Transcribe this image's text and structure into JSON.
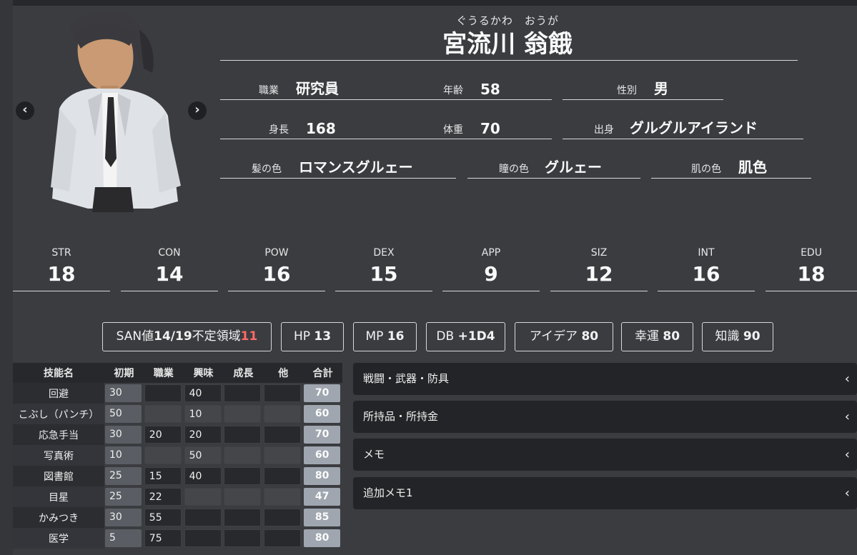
{
  "character": {
    "ruby": "ぐうるかわ　おうが",
    "name": "宮流川 翁餓"
  },
  "profile": {
    "occupation": {
      "label": "職業",
      "value": "研究員"
    },
    "age": {
      "label": "年齢",
      "value": "58"
    },
    "sex": {
      "label": "性別",
      "value": "男"
    },
    "height": {
      "label": "身長",
      "value": "168"
    },
    "weight": {
      "label": "体重",
      "value": "70"
    },
    "origin": {
      "label": "出身",
      "value": "グルグルアイランド"
    },
    "hair": {
      "label": "髪の色",
      "value": "ロマンスグルェー"
    },
    "eyes": {
      "label": "瞳の色",
      "value": "グルェー"
    },
    "skin": {
      "label": "肌の色",
      "value": "肌色"
    }
  },
  "stats": [
    {
      "label": "STR",
      "value": "18"
    },
    {
      "label": "CON",
      "value": "14"
    },
    {
      "label": "POW",
      "value": "16"
    },
    {
      "label": "DEX",
      "value": "15"
    },
    {
      "label": "APP",
      "value": "9"
    },
    {
      "label": "SIZ",
      "value": "12"
    },
    {
      "label": "INT",
      "value": "16"
    },
    {
      "label": "EDU",
      "value": "18"
    }
  ],
  "derived": {
    "san": {
      "prefix": "SAN値",
      "value": "14/19",
      "middle": "不定領域",
      "indefinite": "11"
    },
    "hp": {
      "label": "HP",
      "value": "13"
    },
    "mp": {
      "label": "MP",
      "value": "16"
    },
    "db": {
      "label": "DB",
      "value": "+1D4"
    },
    "idea": {
      "label": "アイデア",
      "value": "80"
    },
    "luck": {
      "label": "幸運",
      "value": "80"
    },
    "knowledge": {
      "label": "知識",
      "value": "90"
    }
  },
  "skills": {
    "headers": [
      "技能名",
      "初期",
      "職業",
      "興味",
      "成長",
      "他",
      "合計"
    ],
    "rows": [
      {
        "name": "回避",
        "init": "30",
        "job": "",
        "interest": "40",
        "growth": "",
        "other": "",
        "total": "70"
      },
      {
        "name": "こぶし（パンチ）",
        "init": "50",
        "job": "",
        "interest": "10",
        "growth": "",
        "other": "",
        "total": "60"
      },
      {
        "name": "応急手当",
        "init": "30",
        "job": "20",
        "interest": "20",
        "growth": "",
        "other": "",
        "total": "70"
      },
      {
        "name": "写真術",
        "init": "10",
        "job": "",
        "interest": "50",
        "growth": "",
        "other": "",
        "total": "60"
      },
      {
        "name": "図書館",
        "init": "25",
        "job": "15",
        "interest": "40",
        "growth": "",
        "other": "",
        "total": "80"
      },
      {
        "name": "目星",
        "init": "25",
        "job": "22",
        "interest": "",
        "growth": "",
        "other": "",
        "total": "47"
      },
      {
        "name": "かみつき",
        "init": "30",
        "job": "55",
        "interest": "",
        "growth": "",
        "other": "",
        "total": "85"
      },
      {
        "name": "医学",
        "init": "5",
        "job": "75",
        "interest": "",
        "growth": "",
        "other": "",
        "total": "80"
      }
    ]
  },
  "panels": [
    {
      "label": "戦闘・武器・防具"
    },
    {
      "label": "所持品・所持金"
    },
    {
      "label": "メモ"
    },
    {
      "label": "追加メモ1"
    }
  ],
  "icons": {
    "prev": "chevron-left-icon",
    "next": "chevron-right-icon",
    "panel": "chevron-left-icon"
  }
}
